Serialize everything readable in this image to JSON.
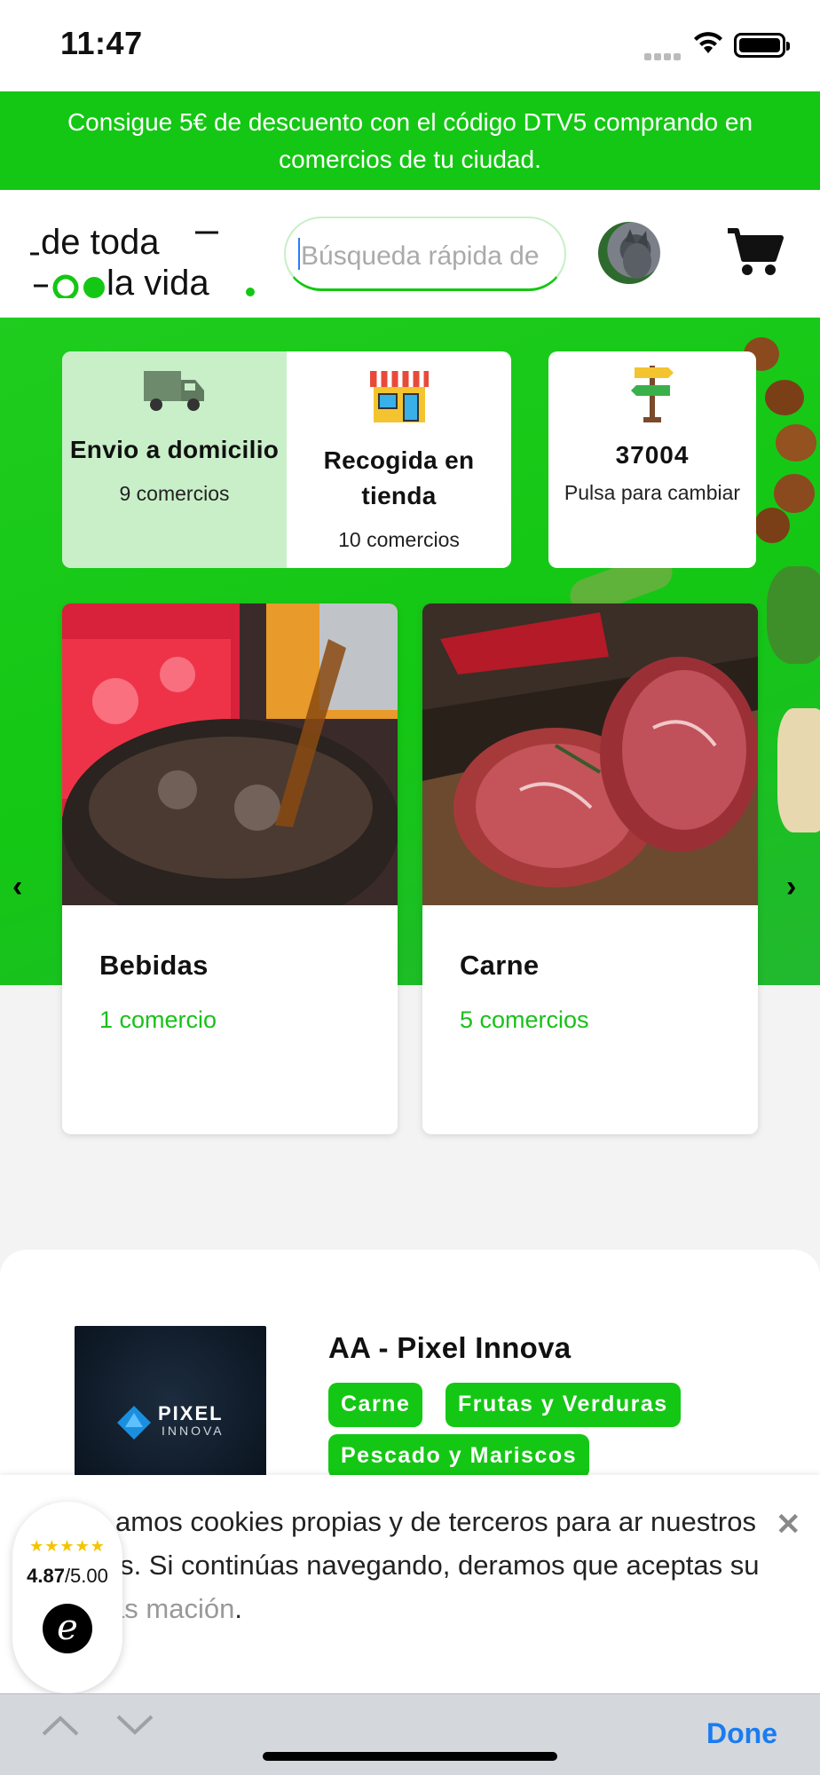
{
  "status_bar": {
    "time": "11:47"
  },
  "promo_banner": {
    "text": "Consigue 5€ de descuento con el código DTV5 comprando en comercios de tu ciudad."
  },
  "header": {
    "logo_line1": "de toda",
    "logo_line2": "la vida",
    "search_placeholder": "Búsqueda rápida de"
  },
  "delivery": {
    "home": {
      "label": "Envio a domicilio",
      "count": "9 comercios",
      "icon": "truck-icon"
    },
    "pickup": {
      "label": "Recogida en tienda",
      "count": "10 comercios",
      "icon": "store-icon"
    }
  },
  "postcode": {
    "code": "37004",
    "hint": "Pulsa para cambiar",
    "icon": "signpost-icon"
  },
  "categories": [
    {
      "name": "Bebidas",
      "shops": "1 comercio"
    },
    {
      "name": "Carne",
      "shops": "5 comercios"
    }
  ],
  "shop": {
    "name": "AA - Pixel Innova",
    "logo_word": "PIXEL",
    "logo_sub": "INNOVA",
    "tags": [
      "Carne",
      "Frutas y Verduras",
      "Pescado y Mariscos"
    ]
  },
  "cookie": {
    "text": "amos cookies propias y de terceros para ar nuestros servicios. Si continúas navegando, deramos que aceptas su uso.",
    "more_link": "Más mación",
    "trailing": "."
  },
  "rating_badge": {
    "stars": "★★★★★",
    "score": "4.87",
    "out_of": "/5.00",
    "mark": "e"
  },
  "keyboard_bar": {
    "done_label": "Done"
  },
  "colors": {
    "brand_green": "#14c714",
    "link_blue": "#1a7cf0"
  }
}
